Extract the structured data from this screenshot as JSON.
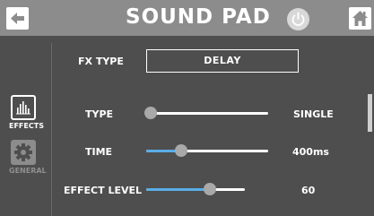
{
  "header": {
    "title": "SOUND PAD"
  },
  "icons": {
    "back": "arrow-left-icon",
    "power": "power-icon",
    "home": "home-icon",
    "effects": "equalizer-icon",
    "general": "gear-icon"
  },
  "sidebar": {
    "items": [
      {
        "label": "EFFECTS",
        "selected": true
      },
      {
        "label": "GENERAL",
        "selected": false
      }
    ]
  },
  "fx": {
    "label": "FX TYPE",
    "value": "DELAY"
  },
  "params": [
    {
      "label": "TYPE",
      "value": "SINGLE",
      "level": 0.0
    },
    {
      "label": "TIME",
      "value": "400ms",
      "level": 0.25
    },
    {
      "label": "EFFECT LEVEL",
      "value": "60",
      "level": 0.6
    }
  ],
  "colors": {
    "accent": "#5aaee6",
    "header": "#8c8c8c",
    "background": "#4e4e4e"
  }
}
